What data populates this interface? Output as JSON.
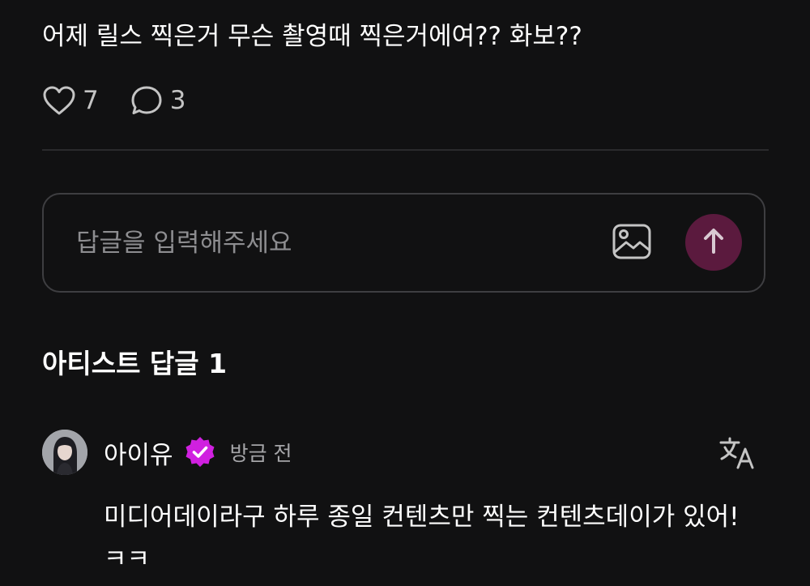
{
  "post": {
    "text": "어제 릴스 찍은거 무슨 촬영때 찍은거에여?? 화보??",
    "likes_count": "7",
    "comments_count": "3"
  },
  "icons": {
    "like": "heart-outline-icon",
    "comment": "speech-bubble-icon",
    "image": "image-icon",
    "send": "arrow-up-icon",
    "verified": "verified-badge-icon",
    "translate": "translate-icon"
  },
  "reply": {
    "placeholder": "답글을 입력해주세요",
    "value": ""
  },
  "artist_replies": {
    "title": "아티스트 답글 1"
  },
  "comment": {
    "author": "아이유",
    "timestamp": "방금 전",
    "text": "미디어데이라구 하루 종일 컨텐츠만 찍는 컨텐츠데이가 있어! ㅋㅋ"
  },
  "colors": {
    "background": "#111112",
    "send_button": "#5b1a3e",
    "verified_badge": "#d020e0",
    "muted_text": "#a5a5a8"
  }
}
